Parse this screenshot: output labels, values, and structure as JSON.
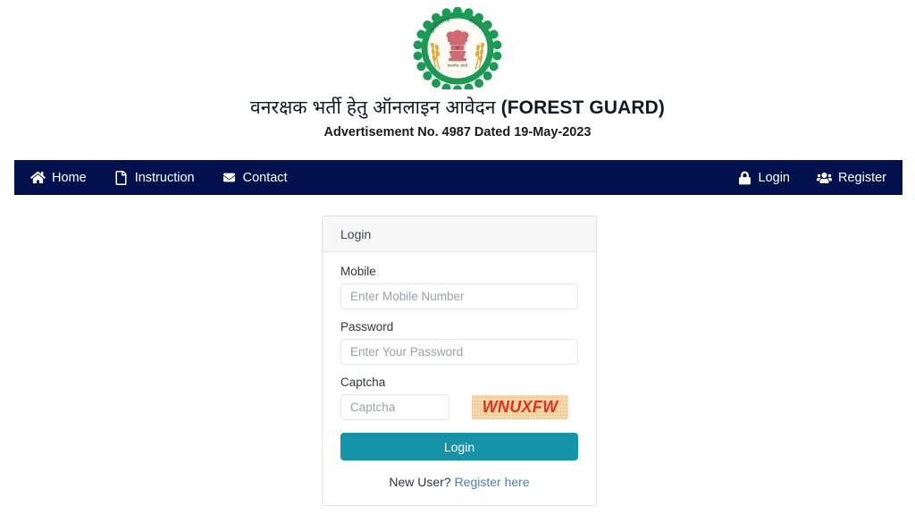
{
  "header": {
    "emblem_name": "chhattisgarh-government-emblem",
    "emblem_text_top": "छत्तीसगढ़",
    "emblem_text_top2": "शासन",
    "emblem_motto": "सत्यमेव जयते",
    "title_hi": "वनरक्षक भर्ती हेतु ऑनलाइन आवेदन ",
    "title_en": "(FOREST GUARD)",
    "subtitle": "Advertisement No. 4987 Dated 19-May-2023"
  },
  "navbar": {
    "background": "#00114d",
    "left_items": [
      {
        "label": "Home",
        "icon": "home-icon"
      },
      {
        "label": "Instruction",
        "icon": "file-icon"
      },
      {
        "label": "Contact",
        "icon": "envelope-icon"
      }
    ],
    "right_items": [
      {
        "label": "Login",
        "icon": "lock-icon"
      },
      {
        "label": "Register",
        "icon": "users-icon"
      }
    ]
  },
  "login_card": {
    "header_title": "Login",
    "mobile": {
      "label": "Mobile",
      "placeholder": "Enter Mobile Number",
      "value": ""
    },
    "password": {
      "label": "Password",
      "placeholder": "Enter Your Password",
      "value": ""
    },
    "captcha": {
      "label": "Captcha",
      "placeholder": "Captcha",
      "value": "",
      "image_text": "WNUXFW",
      "image_text_color": "#e03020",
      "image_background": "#f7dcae"
    },
    "submit_label": "Login",
    "submit_color": "#1593a8",
    "footer_text": "New User? ",
    "footer_link": "Register here",
    "footer_link_color": "#4a7ebb"
  }
}
